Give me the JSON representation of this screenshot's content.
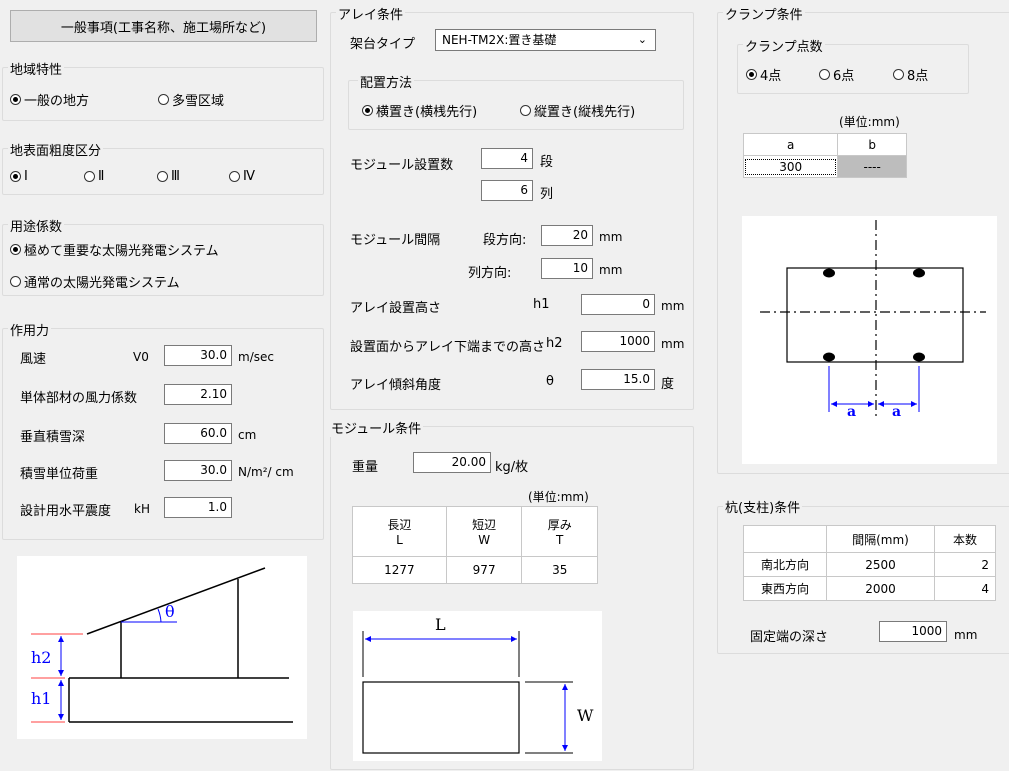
{
  "general": {
    "button_label": "一般事項(工事名称、施工場所など)"
  },
  "region": {
    "title": "地域特性",
    "options": [
      "一般の地方",
      "多雪区域"
    ],
    "selected": 0
  },
  "roughness": {
    "title": "地表面粗度区分",
    "options": [
      "Ⅰ",
      "Ⅱ",
      "Ⅲ",
      "Ⅳ"
    ],
    "selected": 0
  },
  "usage": {
    "title": "用途係数",
    "options": [
      "極めて重要な太陽光発電システム",
      "通常の太陽光発電システム"
    ],
    "selected": 0
  },
  "force": {
    "title": "作用力",
    "wind": {
      "label": "風速",
      "symbol": "V0",
      "value": "30.0",
      "unit": "m/sec"
    },
    "wind_coef": {
      "label": "単体部材の風力係数",
      "value": "2.10"
    },
    "snow_depth": {
      "label": "垂直積雪深",
      "value": "60.0",
      "unit": "cm"
    },
    "snow_load": {
      "label": "積雪単位荷重",
      "value": "30.0",
      "unit": "N/m²/ cm"
    },
    "seismic": {
      "label": "設計用水平震度",
      "symbol": "kH",
      "value": "1.0"
    }
  },
  "side_diagram": {
    "h1": "h1",
    "h2": "h2",
    "theta": "θ"
  },
  "array": {
    "title": "アレイ条件",
    "frame_label": "架台タイプ",
    "frame_value": "NEH-TM2X:置き基礎",
    "layout": {
      "title": "配置方法",
      "options": [
        "横置き(横桟先行)",
        "縦置き(縦桟先行)"
      ],
      "selected": 0
    },
    "count_label": "モジュール設置数",
    "rows_value": "4",
    "rows_unit": "段",
    "cols_value": "6",
    "cols_unit": "列",
    "spacing_label": "モジュール間隔",
    "spacing_row_label": "段方向:",
    "spacing_row_value": "20",
    "spacing_row_unit": "mm",
    "spacing_col_label": "列方向:",
    "spacing_col_value": "10",
    "spacing_col_unit": "mm",
    "height_label": "アレイ設置高さ",
    "height_symbol": "h1",
    "height_value": "0",
    "height_unit": "mm",
    "lower_label": "設置面からアレイ下端までの高さ",
    "lower_symbol": "h2",
    "lower_value": "1000",
    "lower_unit": "mm",
    "tilt_label": "アレイ傾斜角度",
    "tilt_symbol": "θ",
    "tilt_value": "15.0",
    "tilt_unit": "度"
  },
  "module": {
    "title": "モジュール条件",
    "weight_label": "重量",
    "weight_value": "20.00",
    "weight_unit": "kg/枚",
    "unit_note": "(単位:mm)",
    "headers": [
      [
        "長辺",
        "L"
      ],
      [
        "短辺",
        "W"
      ],
      [
        "厚み",
        "T"
      ]
    ],
    "values": [
      "1277",
      "977",
      "35"
    ],
    "diagram": {
      "L": "L",
      "W": "W"
    }
  },
  "clamp": {
    "title": "クランプ条件",
    "points_title": "クランプ点数",
    "options": [
      "4点",
      "6点",
      "8点"
    ],
    "selected": 0,
    "unit_note": "(単位:mm)",
    "headers": [
      "a",
      "b"
    ],
    "values": [
      "300",
      "----"
    ],
    "diagram": {
      "a": "a"
    }
  },
  "pile": {
    "title": "杭(支柱)条件",
    "headers": [
      "",
      "間隔(mm)",
      "本数"
    ],
    "rows": [
      [
        "南北方向",
        "2500",
        "2"
      ],
      [
        "東西方向",
        "2000",
        "4"
      ]
    ],
    "depth_label": "固定端の深さ",
    "depth_value": "1000",
    "depth_unit": "mm"
  }
}
